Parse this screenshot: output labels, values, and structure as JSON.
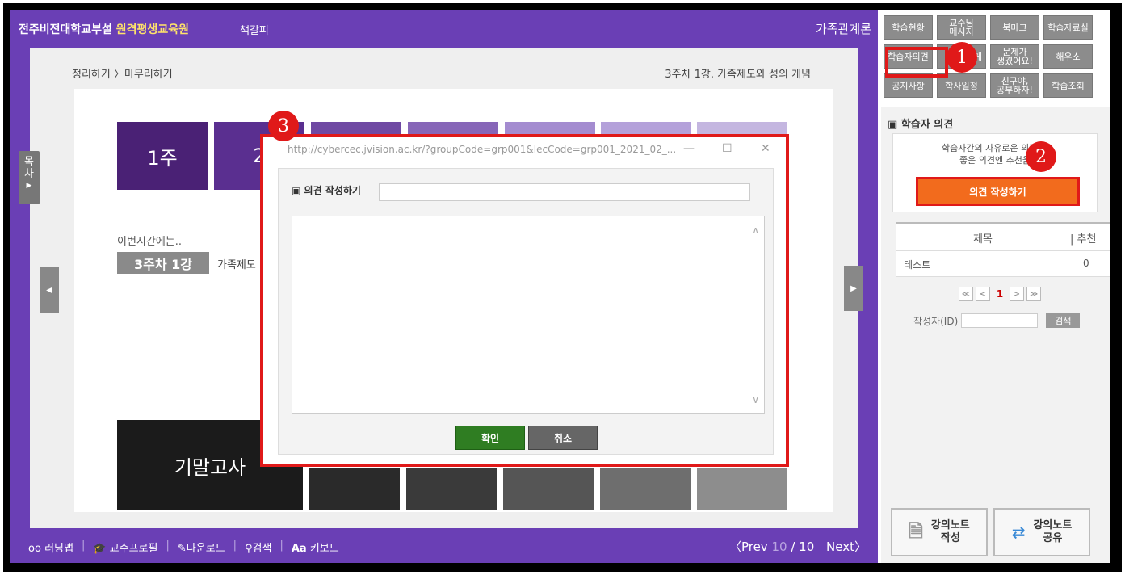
{
  "header": {
    "org": "전주비전대학교부설",
    "org_highlight": "원격평생교육원",
    "bookmark": "책갈피",
    "course": "가족관계론"
  },
  "content": {
    "breadcrumb": "정리하기 〉마무리하기",
    "lesson": "3주차 1강. 가족제도와 성의 개념",
    "side_tab": "목\n차",
    "week1": "1주",
    "week2": "2",
    "intro": "이번시간에는..",
    "week_badge": "3주차 1강",
    "week_text": "가족제도",
    "final_exam": "기말고사"
  },
  "bottom": {
    "learning_map": "러닝맵",
    "prof_profile": "교수프로필",
    "download": "다운로드",
    "search": "검색",
    "keyboard": "키보드",
    "prev": "〈Prev",
    "page_cur": "10",
    "page_total": "/ 10",
    "next": "Next〉"
  },
  "top_buttons": {
    "b1": "학습현황",
    "b2": "교수님\n메시지",
    "b3": "북마크",
    "b4": "학습자료실",
    "b5": "학습자의견",
    "b6": "게",
    "b7": "문제가\n생겼어요!",
    "b8": "해우소",
    "b9": "공지사항",
    "b10": "학사일정",
    "b11": "친구야,\n공부하자!",
    "b12": "학습조회"
  },
  "panel": {
    "title": "학습자 의견",
    "desc": "학습자간의 자유로운 의견      고\n좋은 의견엔 추천을",
    "write_button": "의견 작성하기",
    "col_title": "제목",
    "col_recommend": "| 추천",
    "row_title": "테스트",
    "row_count": "0",
    "page_first": "≪",
    "page_prev": "<",
    "page_num": "1",
    "page_next": ">",
    "page_last": "≫",
    "author_label": "작성자(ID)",
    "search_button": "검색",
    "note_write": "강의노트\n작성",
    "note_share": "강의노트\n공유"
  },
  "dialog": {
    "url": "http://cybercec.jvision.ac.kr/?groupCode=grp001&lecCode=grp001_2021_02_...",
    "label": "의견 작성하기",
    "ok": "확인",
    "cancel": "취소"
  },
  "markers": {
    "m1": "1",
    "m2": "2",
    "m3": "3"
  },
  "colors": {
    "frame": "#000000",
    "sidebar_purple": "#6a3fb5",
    "highlight_red": "#e01919",
    "write_orange": "#f26b1d",
    "ok_green": "#2f7d22"
  }
}
